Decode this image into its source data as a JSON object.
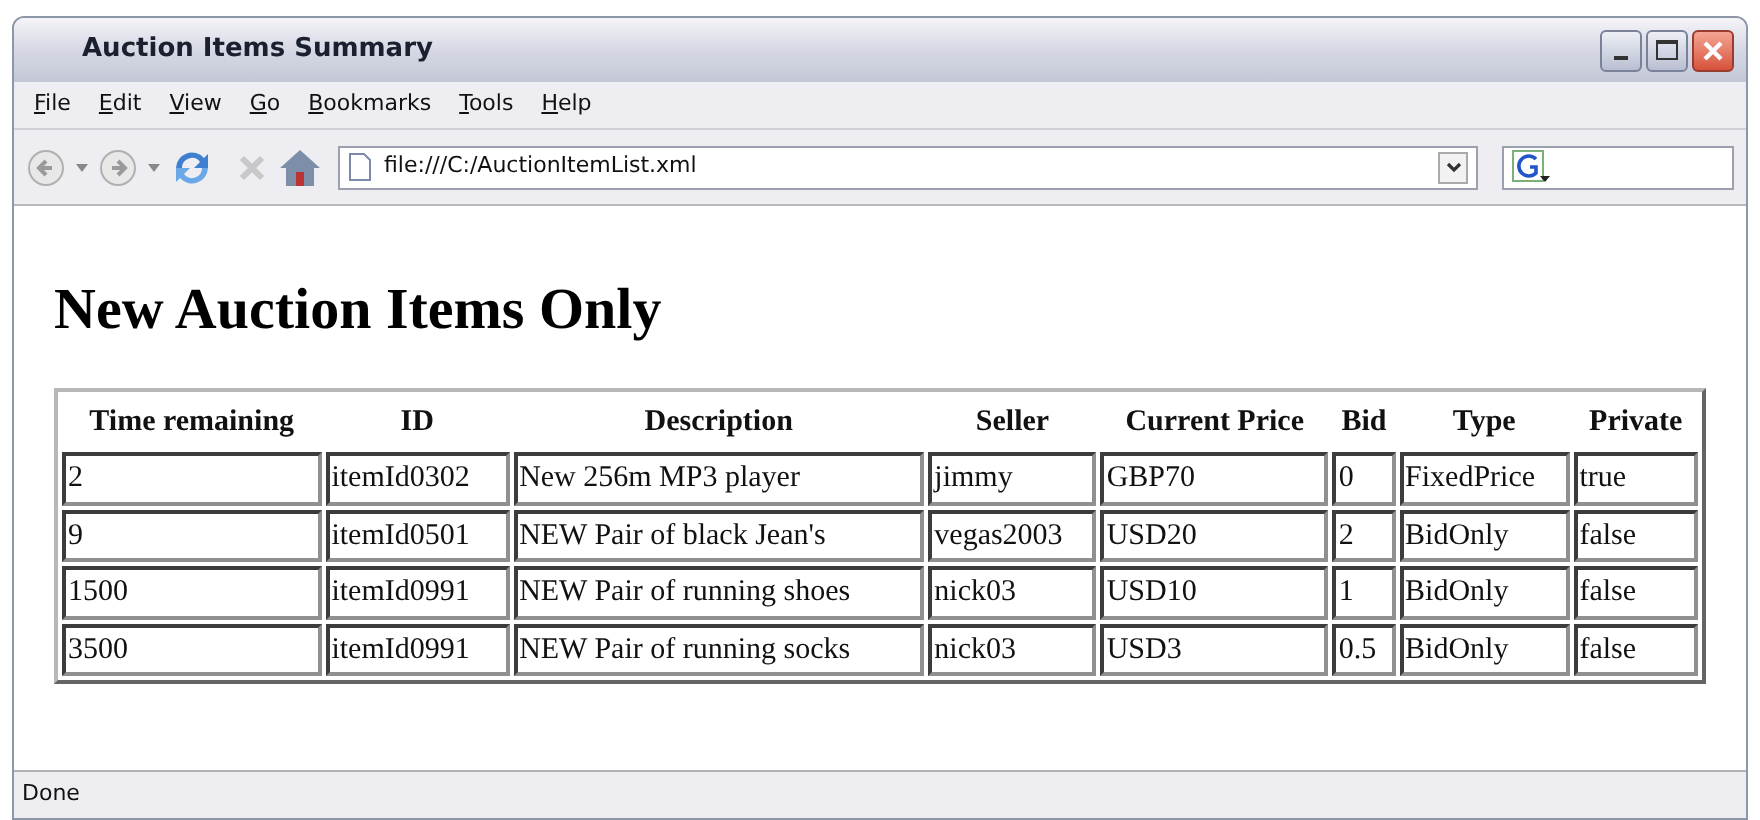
{
  "window": {
    "title": "Auction Items Summary"
  },
  "menu": [
    "File",
    "Edit",
    "View",
    "Go",
    "Bookmarks",
    "Tools",
    "Help"
  ],
  "address_bar": {
    "value": "file:///C:/AuctionItemList.xml"
  },
  "page": {
    "heading": "New Auction Items Only",
    "table": {
      "columns": [
        "Time remaining",
        "ID",
        "Description",
        "Seller",
        "Current Price",
        "Bid",
        "Type",
        "Private"
      ],
      "rows": [
        [
          "2",
          "itemId0302",
          "New 256m MP3 player",
          "jimmy",
          "GBP70",
          "0",
          "FixedPrice",
          "true"
        ],
        [
          "9",
          "itemId0501",
          "NEW Pair of black Jean's",
          "vegas2003",
          "USD20",
          "2",
          "BidOnly",
          "false"
        ],
        [
          "1500",
          "itemId0991",
          "NEW Pair of running shoes",
          "nick03",
          "USD10",
          "1",
          "BidOnly",
          "false"
        ],
        [
          "3500",
          "itemId0991",
          "NEW Pair of running socks",
          "nick03",
          "USD3",
          "0.5",
          "BidOnly",
          "false"
        ]
      ]
    }
  },
  "status_bar": {
    "text": "Done"
  }
}
